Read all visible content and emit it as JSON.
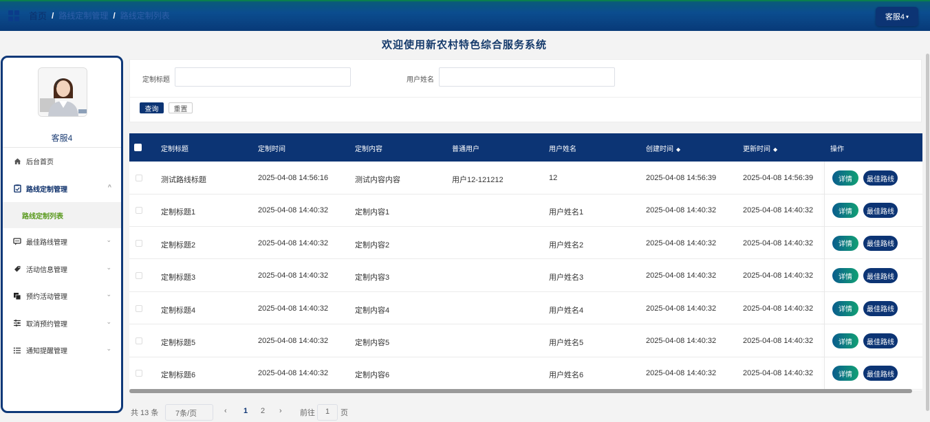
{
  "header": {
    "breadcrumbs": [
      "首页",
      "路线定制管理",
      "路线定制列表"
    ],
    "user_button": "客服4"
  },
  "page_title": "欢迎使用新农村特色综合服务系统",
  "sidebar": {
    "username": "客服4",
    "items": [
      {
        "label": "后台首页",
        "icon": "home-icon"
      },
      {
        "label": "路线定制管理",
        "icon": "clipboard-icon",
        "expanded": true
      },
      {
        "label": "最佳路线管理",
        "icon": "message-icon"
      },
      {
        "label": "活动信息管理",
        "icon": "tag-icon"
      },
      {
        "label": "预约活动管理",
        "icon": "copy-icon"
      },
      {
        "label": "取消预约管理",
        "icon": "sliders-icon"
      },
      {
        "label": "通知提醒管理",
        "icon": "list-icon"
      }
    ],
    "subitem": "路线定制列表"
  },
  "search": {
    "title_label": "定制标题",
    "name_label": "用户姓名",
    "query_button": "查询",
    "reset_button": "重置"
  },
  "table": {
    "columns": [
      "定制标题",
      "定制时间",
      "定制内容",
      "普通用户",
      "用户姓名",
      "创建时间",
      "更新时间",
      "操作"
    ],
    "rows": [
      {
        "title": "测试路线标题",
        "time": "2025-04-08 14:56:16",
        "content": "测试内容内容",
        "user": "用户12-121212",
        "name": "12",
        "created": "2025-04-08 14:56:39",
        "updated": "2025-04-08 14:56:39"
      },
      {
        "title": "定制标题1",
        "time": "2025-04-08 14:40:32",
        "content": "定制内容1",
        "user": "",
        "name": "用户姓名1",
        "created": "2025-04-08 14:40:32",
        "updated": "2025-04-08 14:40:32"
      },
      {
        "title": "定制标题2",
        "time": "2025-04-08 14:40:32",
        "content": "定制内容2",
        "user": "",
        "name": "用户姓名2",
        "created": "2025-04-08 14:40:32",
        "updated": "2025-04-08 14:40:32"
      },
      {
        "title": "定制标题3",
        "time": "2025-04-08 14:40:32",
        "content": "定制内容3",
        "user": "",
        "name": "用户姓名3",
        "created": "2025-04-08 14:40:32",
        "updated": "2025-04-08 14:40:32"
      },
      {
        "title": "定制标题4",
        "time": "2025-04-08 14:40:32",
        "content": "定制内容4",
        "user": "",
        "name": "用户姓名4",
        "created": "2025-04-08 14:40:32",
        "updated": "2025-04-08 14:40:32"
      },
      {
        "title": "定制标题5",
        "time": "2025-04-08 14:40:32",
        "content": "定制内容5",
        "user": "",
        "name": "用户姓名5",
        "created": "2025-04-08 14:40:32",
        "updated": "2025-04-08 14:40:32"
      },
      {
        "title": "定制标题6",
        "time": "2025-04-08 14:40:32",
        "content": "定制内容6",
        "user": "",
        "name": "用户姓名6",
        "created": "2025-04-08 14:40:32",
        "updated": "2025-04-08 14:40:32"
      }
    ],
    "detail_button": "详情",
    "route_button": "最佳路线"
  },
  "pagination": {
    "total": "共 13 条",
    "page_size": "7条/页",
    "pages": [
      "1",
      "2"
    ],
    "goto_label": "前往",
    "goto_value": "1",
    "page_suffix": "页"
  },
  "colors": {
    "primary": "#0c3474",
    "accent_green": "#5a9a1f"
  }
}
